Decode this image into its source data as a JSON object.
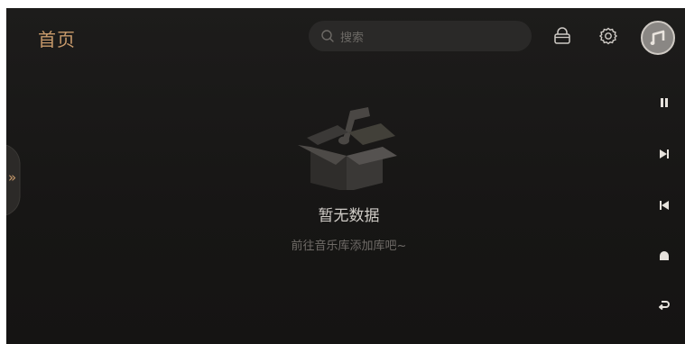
{
  "header": {
    "title": "首页",
    "search_placeholder": "搜索"
  },
  "toolbar_icons": [
    "bag-icon",
    "settings-icon",
    "avatar-music-icon"
  ],
  "side_controls": [
    "pause-icon",
    "next-track-icon",
    "previous-track-icon",
    "home-icon",
    "back-icon"
  ],
  "drawer_toggle_glyph": "»",
  "empty_state": {
    "title": "暂无数据",
    "subtitle": "前往音乐库添加库吧~"
  },
  "colors": {
    "accent": "#c89a6b",
    "background": "#1a1918",
    "text_primary": "#cfcbc6",
    "text_secondary": "#6f6b67"
  }
}
